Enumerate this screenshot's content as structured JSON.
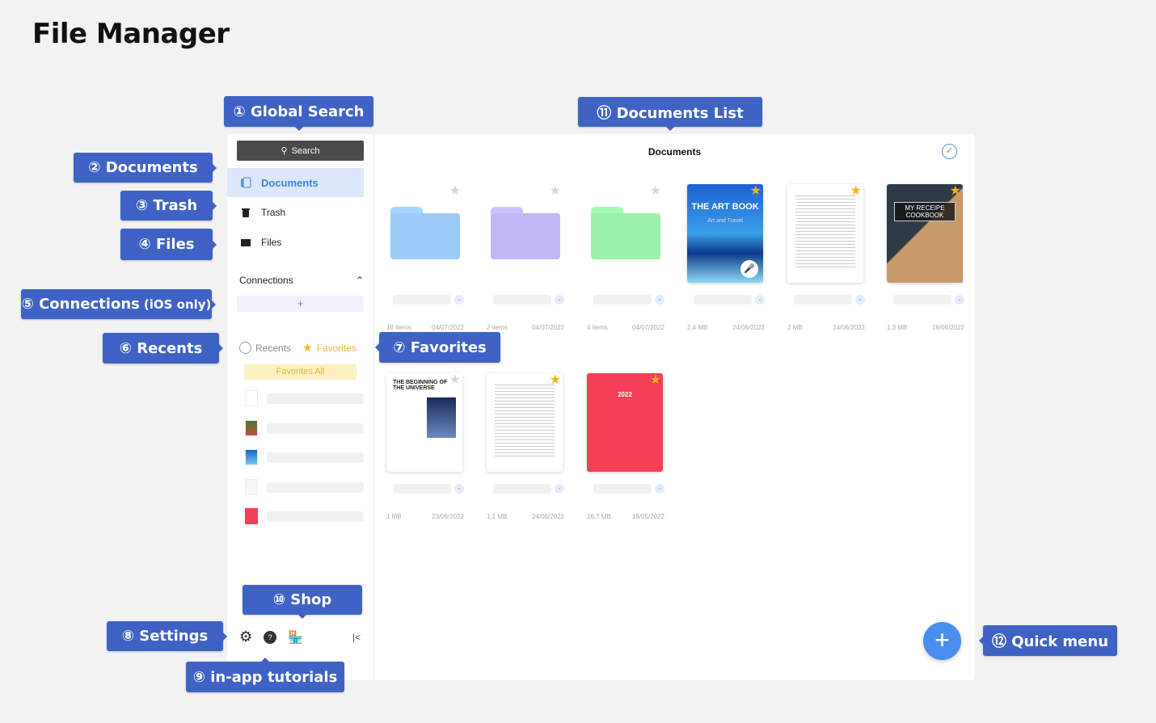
{
  "page_title": "File Manager",
  "sidebar": {
    "search_label": "Search",
    "nav": [
      {
        "label": "Documents",
        "icon": "documents-icon"
      },
      {
        "label": "Trash",
        "icon": "trash-icon"
      },
      {
        "label": "Files",
        "icon": "folder-icon"
      }
    ],
    "connections_label": "Connections",
    "add_connection": "+",
    "recents_tab": "Recents",
    "favorites_tab": "Favorites",
    "favorites_all": "Favorites All",
    "collapse": "|<"
  },
  "main": {
    "title": "Documents",
    "items": [
      {
        "kind": "folder",
        "color": "#9ccbf7",
        "starred": false,
        "meta_left": "18 items",
        "meta_right": "04/07/2022"
      },
      {
        "kind": "folder",
        "color": "#c0b9f5",
        "starred": false,
        "meta_left": "2 items",
        "meta_right": "04/07/2022"
      },
      {
        "kind": "folder",
        "color": "#9af0a8",
        "starred": false,
        "meta_left": "4 items",
        "meta_right": "04/07/2022"
      },
      {
        "kind": "art",
        "cover_title": "THE ART BOOK",
        "cover_sub": "Art and Travel",
        "starred": true,
        "meta_left": "2,4 MB",
        "meta_right": "24/06/2022"
      },
      {
        "kind": "paper",
        "starred": true,
        "meta_left": "2 MB",
        "meta_right": "24/06/2022"
      },
      {
        "kind": "recipe",
        "cover_title": "MY RECEIPE COOKBOOK",
        "starred": true,
        "meta_left": "1,3 MB",
        "meta_right": "16/06/2022"
      },
      {
        "kind": "universe",
        "cover_title": "THE BEGINNING OF THE UNIVERSE",
        "starred": false,
        "meta_left": "1 MB",
        "meta_right": "23/06/2022"
      },
      {
        "kind": "paper2",
        "starred": true,
        "meta_left": "1,1 MB",
        "meta_right": "24/06/2022"
      },
      {
        "kind": "red",
        "cover_title": "2022",
        "starred": true,
        "meta_left": "16,7 MB",
        "meta_right": "16/05/2022"
      }
    ]
  },
  "callouts": {
    "global_search": "① Global Search",
    "documents": "② Documents",
    "trash": "③ Trash",
    "files": "④ Files",
    "connections": "⑤ Connections",
    "connections_note": "(iOS only)",
    "recents": "⑥ Recents",
    "favorites": "⑦ Favorites",
    "settings": "⑧ Settings",
    "tutorials": "⑨ in-app tutorials",
    "shop": "⑩ Shop",
    "documents_list": "⑪ Documents List",
    "quick_menu": "⑫ Quick menu"
  },
  "colors": {
    "accent": "#3f63c4",
    "fab": "#4a8ef0",
    "favorite": "#f5b31b"
  }
}
